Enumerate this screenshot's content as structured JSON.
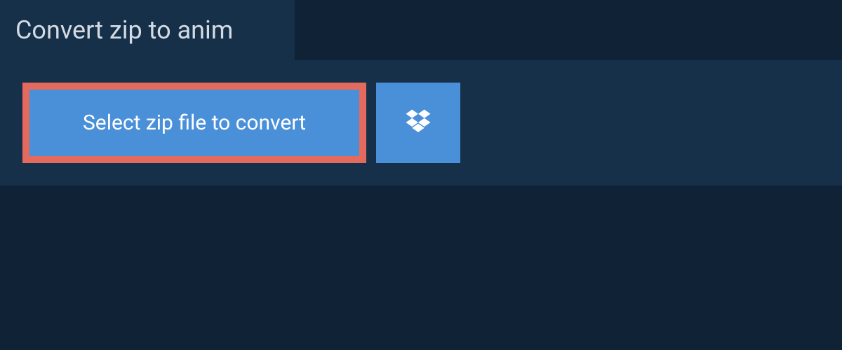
{
  "header": {
    "title": "Convert zip to anim"
  },
  "actions": {
    "select_label": "Select zip file to convert",
    "dropbox_icon": "dropbox"
  },
  "colors": {
    "background": "#0f2236",
    "panel": "#16304a",
    "button": "#4a90d9",
    "highlight_border": "#e46a5e",
    "text_light": "#d4dbe2",
    "text_white": "#ffffff"
  }
}
